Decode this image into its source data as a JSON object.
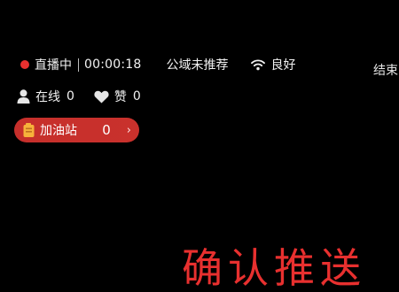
{
  "status": {
    "live_label": "直播中",
    "timer": "00:00:18",
    "recommend": "公域未推荐",
    "network": "良好"
  },
  "end_label": "结束",
  "stats": {
    "online_label": "在线",
    "online_count": "0",
    "likes_label": "赞",
    "likes_count": "0"
  },
  "gas_station": {
    "label": "加油站",
    "count": "0",
    "chevron": "›"
  },
  "overlay_text": "确认推送",
  "colors": {
    "background": "#000000",
    "accent_red": "#e8302f",
    "pill_red": "#c62f2b"
  },
  "icons": {
    "live": "red-dot-icon",
    "network": "wifi-icon",
    "online": "person-icon",
    "likes": "heart-icon",
    "gas": "fuel-can-icon",
    "more": "chevron-right-icon"
  }
}
